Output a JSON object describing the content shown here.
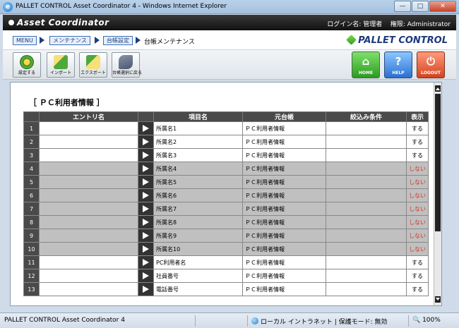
{
  "window": {
    "title": "PALLET CONTROL Asset Coordinator 4 - Windows Internet Explorer",
    "min_glyph": "—",
    "max_glyph": "□",
    "close_glyph": "✕"
  },
  "header": {
    "logo": "Asset Coordinator",
    "login_label": "ログイン名: 管理者",
    "role_label": "権限: Administrator"
  },
  "breadcrumb": {
    "menu": "MENU",
    "maintenance": "メンテナンス",
    "ledger_settings": "台帳設定",
    "current": "台帳メンテナンス"
  },
  "brand": "PALLET CONTROL",
  "toolbar": {
    "settings": "設定する",
    "import": "インポート",
    "export": "エクスポート",
    "back": "台帳選択に戻る",
    "home": "HOME",
    "help": "HELP",
    "logout": "LOGOUT",
    "home_glyph": "⌂",
    "help_glyph": "?",
    "logout_glyph": "⏻"
  },
  "section_title": "［ ＰＣ利用者情報 ］",
  "table": {
    "headers": [
      "エントリ名",
      "項目名",
      "元台帳",
      "絞込み条件",
      "表示"
    ],
    "rows": [
      {
        "num": "1",
        "entry": "",
        "item": "所属名1",
        "source": "ＰＣ利用者情報",
        "filter": "",
        "display": "する",
        "on": true
      },
      {
        "num": "2",
        "entry": "",
        "item": "所属名2",
        "source": "ＰＣ利用者情報",
        "filter": "",
        "display": "する",
        "on": true
      },
      {
        "num": "3",
        "entry": "",
        "item": "所属名3",
        "source": "ＰＣ利用者情報",
        "filter": "",
        "display": "する",
        "on": true
      },
      {
        "num": "4",
        "entry": "",
        "item": "所属名4",
        "source": "ＰＣ利用者情報",
        "filter": "",
        "display": "しない",
        "on": false
      },
      {
        "num": "5",
        "entry": "",
        "item": "所属名5",
        "source": "ＰＣ利用者情報",
        "filter": "",
        "display": "しない",
        "on": false
      },
      {
        "num": "6",
        "entry": "",
        "item": "所属名6",
        "source": "ＰＣ利用者情報",
        "filter": "",
        "display": "しない",
        "on": false
      },
      {
        "num": "7",
        "entry": "",
        "item": "所属名7",
        "source": "ＰＣ利用者情報",
        "filter": "",
        "display": "しない",
        "on": false
      },
      {
        "num": "8",
        "entry": "",
        "item": "所属名8",
        "source": "ＰＣ利用者情報",
        "filter": "",
        "display": "しない",
        "on": false
      },
      {
        "num": "9",
        "entry": "",
        "item": "所属名9",
        "source": "ＰＣ利用者情報",
        "filter": "",
        "display": "しない",
        "on": false
      },
      {
        "num": "10",
        "entry": "",
        "item": "所属名10",
        "source": "ＰＣ利用者情報",
        "filter": "",
        "display": "しない",
        "on": false
      },
      {
        "num": "11",
        "entry": "",
        "item": "PC利用者名",
        "source": "ＰＣ利用者情報",
        "filter": "",
        "display": "する",
        "on": true
      },
      {
        "num": "12",
        "entry": "",
        "item": "社員番号",
        "source": "ＰＣ利用者情報",
        "filter": "",
        "display": "する",
        "on": true
      },
      {
        "num": "13",
        "entry": "",
        "item": "電話番号",
        "source": "ＰＣ利用者情報",
        "filter": "",
        "display": "する",
        "on": true
      }
    ]
  },
  "statusbar": {
    "text": "PALLET CONTROL Asset Coordinator 4",
    "zone": "ローカル イントラネット | 保護モード: 無効",
    "zoom": "100%"
  },
  "colors": {
    "header_bg": "#1a1a1a",
    "table_header_bg": "#4a4a4a",
    "disabled_row_bg": "#c0c0c0",
    "hidden_text": "#d03020",
    "crumb_border": "#3c6eb4"
  }
}
